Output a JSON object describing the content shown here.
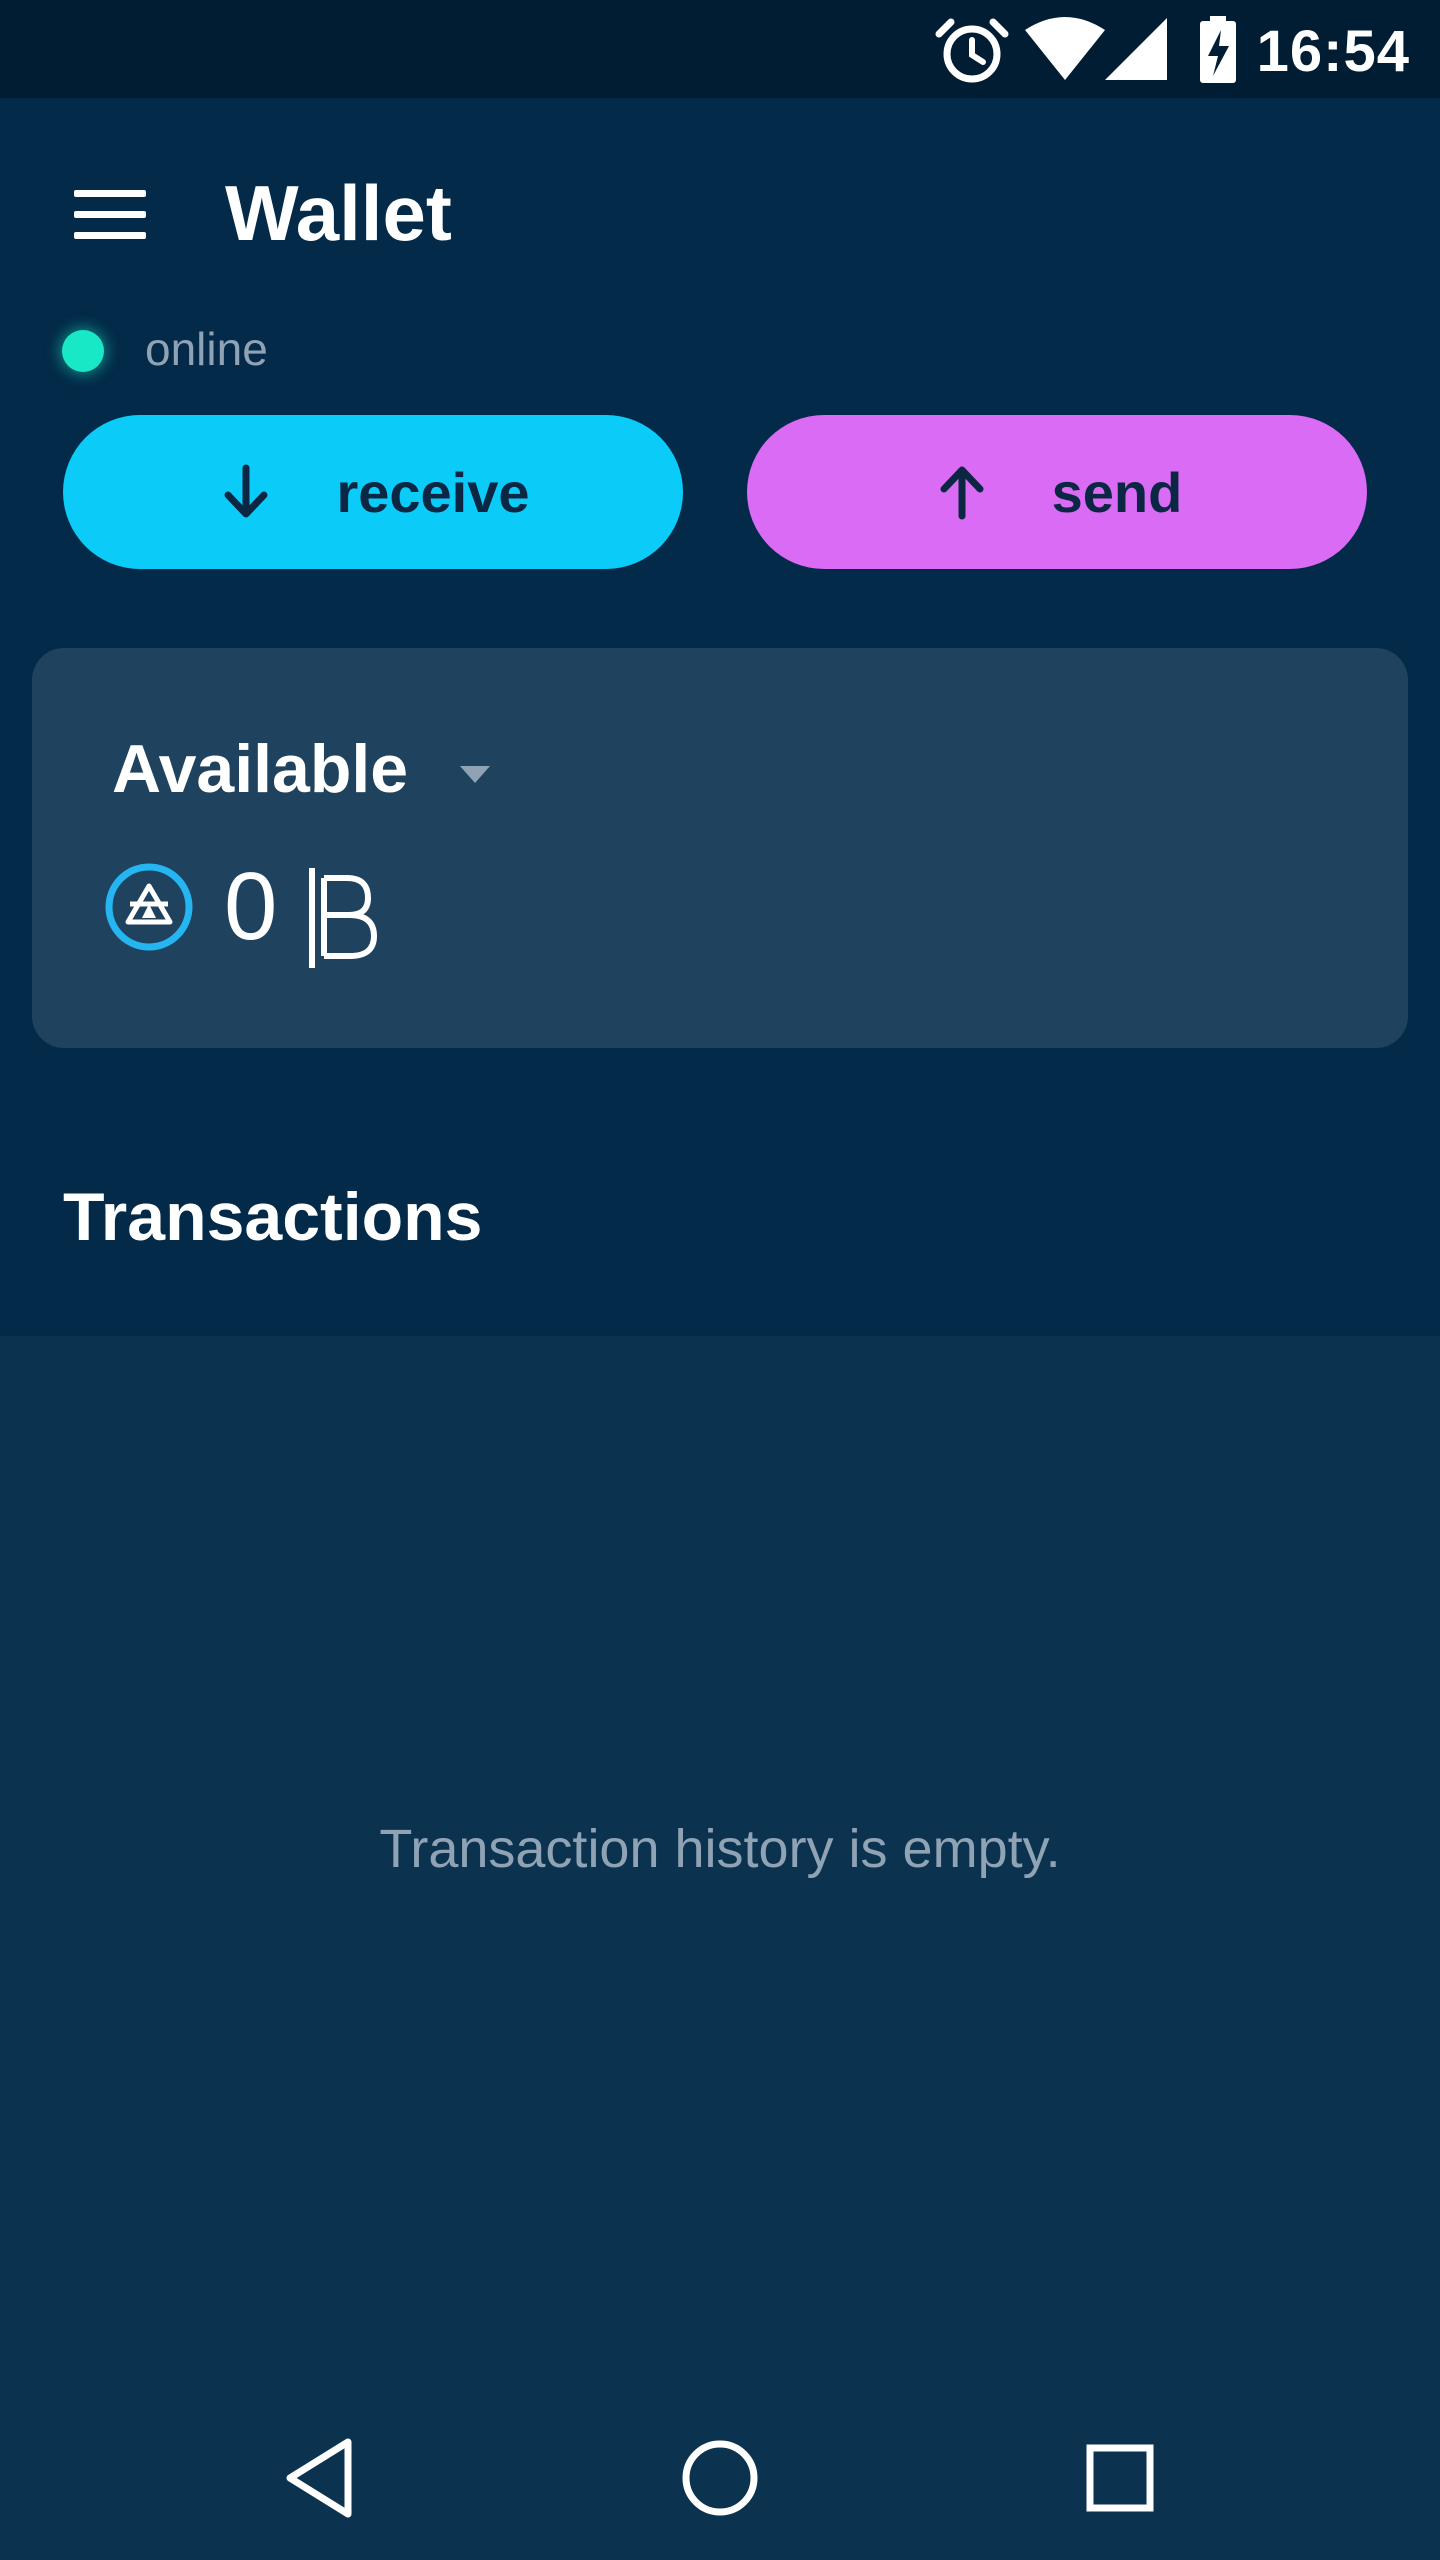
{
  "status_bar": {
    "time": "16:54",
    "icons": [
      "alarm-icon",
      "wifi-icon",
      "signal-icon",
      "battery-charging-icon"
    ]
  },
  "app_bar": {
    "title": "Wallet",
    "menu_icon": "hamburger-menu-icon"
  },
  "connection": {
    "status": "online",
    "indicator_color": "#19E8C7"
  },
  "actions": {
    "receive_label": "receive",
    "receive_icon": "arrow-down-icon",
    "receive_color": "#0BCCF8",
    "send_label": "send",
    "send_icon": "arrow-up-icon",
    "send_color": "#DA6BF5"
  },
  "balance": {
    "label": "Available",
    "amount": "0",
    "currency_icon": "coin-icon",
    "currency_symbol_icon": "beam-currency-symbol-icon"
  },
  "transactions": {
    "title": "Transactions",
    "empty_message": "Transaction history is empty."
  },
  "nav_bar": {
    "icons": [
      "back-icon",
      "home-icon",
      "recents-icon"
    ]
  }
}
